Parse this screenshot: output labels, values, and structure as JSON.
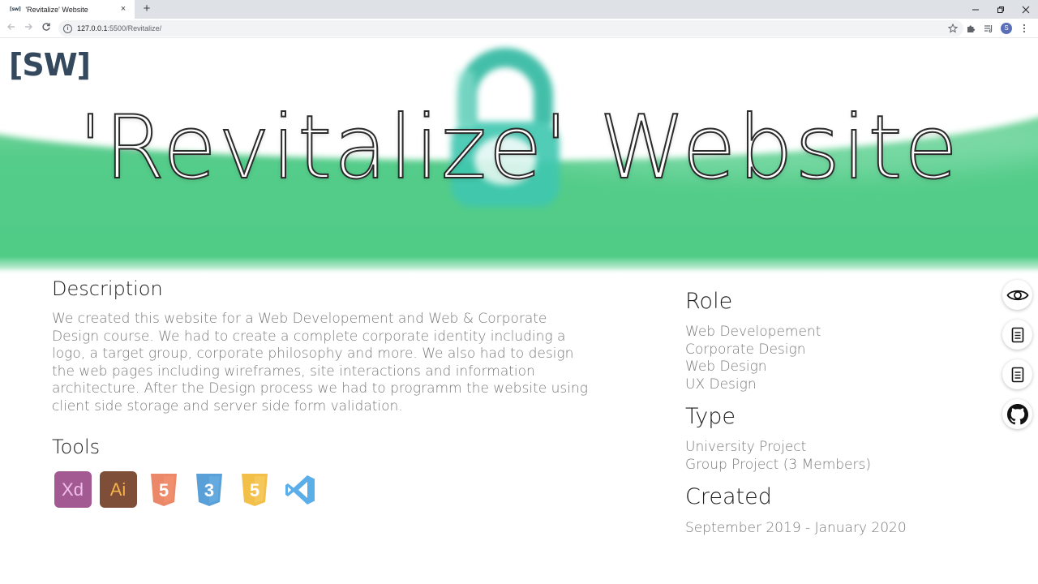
{
  "browser": {
    "tab_favicon": "[sw]",
    "tab_title": "'Revitalize' Website",
    "tab_close": "×",
    "new_tab": "+",
    "url_host": "127.0.0.1",
    "url_rest": ":5500/Revitalize/",
    "profile_initial": "S"
  },
  "page": {
    "logo": "[SW]",
    "hero_title": "'Revitalize' Website",
    "description": {
      "heading": "Description",
      "text": "We created this website for a Web Developement and Web & Corporate Design course. We had to create a complete corporate identity including a logo, a target group, corporate philosophy and more. We also had to design the web pages including wireframes, site interactions and information architecture. After the Design process we had to programm the website using client side storage and server side form validation."
    },
    "tools": {
      "heading": "Tools",
      "items": [
        {
          "name": "adobe-xd",
          "label": "Xd",
          "color": "#a35a92"
        },
        {
          "name": "adobe-illustrator",
          "label": "Ai",
          "color": "#7e4e38"
        },
        {
          "name": "html5",
          "label": "5",
          "color": "#e8734f"
        },
        {
          "name": "css3",
          "label": "3",
          "color": "#3d8fd1"
        },
        {
          "name": "javascript",
          "label": "5",
          "color": "#f0b429"
        },
        {
          "name": "vscode",
          "label": "",
          "color": "#3ea0e4"
        }
      ]
    },
    "role": {
      "heading": "Role",
      "items": [
        "Web Developement",
        "Corporate Design",
        "Web Design",
        "UX Design"
      ]
    },
    "type": {
      "heading": "Type",
      "items": [
        "University Project",
        "Group Project (3 Members)"
      ]
    },
    "created": {
      "heading": "Created",
      "text": "September 2019 - January 2020"
    },
    "side_links": [
      "eye-icon",
      "document-icon",
      "document-icon",
      "github-icon"
    ],
    "colors": {
      "hero_green": "#4fcc86",
      "logo": "#34495e",
      "body_text": "#7a7a7a",
      "heading": "#1c1c1c"
    }
  }
}
